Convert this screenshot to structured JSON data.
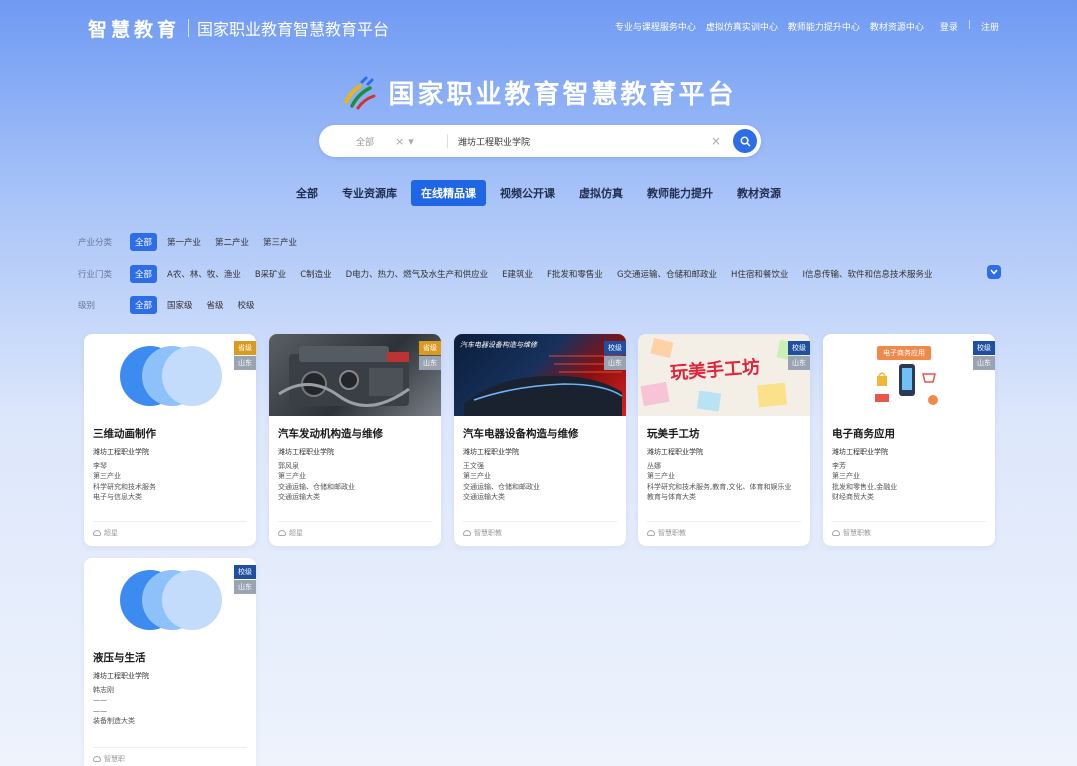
{
  "header": {
    "brand_mark": "智慧教育",
    "brand_name": "国家职业教育智慧教育平台",
    "nav": [
      "专业与课程服务中心",
      "虚拟仿真实训中心",
      "教师能力提升中心",
      "教材资源中心"
    ],
    "login": "登录",
    "sep": "|",
    "register": "注册"
  },
  "hero": {
    "title": "国家职业教育智慧教育平台"
  },
  "search": {
    "scope": "全部",
    "scope_clear": "×",
    "scope_arrow": "▾",
    "value": "潍坊工程职业学院",
    "clear": "×",
    "button_icon": "search-icon"
  },
  "tabs": [
    {
      "label": "全部",
      "active": false
    },
    {
      "label": "专业资源库",
      "active": false
    },
    {
      "label": "在线精品课",
      "active": true
    },
    {
      "label": "视频公开课",
      "active": false
    },
    {
      "label": "虚拟仿真",
      "active": false
    },
    {
      "label": "教师能力提升",
      "active": false
    },
    {
      "label": "教材资源",
      "active": false
    }
  ],
  "filters": {
    "industry": {
      "label": "产业分类",
      "options": [
        "全部",
        "第一产业",
        "第二产业",
        "第三产业"
      ]
    },
    "sector": {
      "label": "行业门类",
      "options": [
        "全部",
        "A农、林、牧、渔业",
        "B采矿业",
        "C制造业",
        "D电力、热力、燃气及水生产和供应业",
        "E建筑业",
        "F批发和零售业",
        "G交通运输、仓储和邮政业",
        "H住宿和餐饮业",
        "I信息传输、软件和信息技术服务业"
      ]
    },
    "level": {
      "label": "级别",
      "options": [
        "全部",
        "国家级",
        "省级",
        "校级"
      ]
    }
  },
  "cards": [
    {
      "title": "三维动画制作",
      "school": "潍坊工程职业学院",
      "lines": [
        "李琴",
        "第三产业",
        "科学研究和技术服务",
        "电子与信息大类"
      ],
      "level": "省级",
      "region": "山东",
      "footer": "超星"
    },
    {
      "title": "汽车发动机构造与维修",
      "school": "潍坊工程职业学院",
      "lines": [
        "郭风泉",
        "第三产业",
        "交通运输、仓储和邮政业",
        "交通运输大类"
      ],
      "level": "省级",
      "region": "山东",
      "footer": "超星"
    },
    {
      "title": "汽车电器设备构造与维修",
      "school": "潍坊工程职业学院",
      "lines": [
        "王文强",
        "第三产业",
        "交通运输、仓储和邮政业",
        "交通运输大类"
      ],
      "level": "校级",
      "region": "山东",
      "footer": "智慧职教",
      "cover_text": "汽车电器设备构造与维修"
    },
    {
      "title": "玩美手工坊",
      "school": "潍坊工程职业学院",
      "lines": [
        "丛娜",
        "第三产业",
        "科学研究和技术服务,教育,文化、体育和娱乐业",
        "教育与体育大类"
      ],
      "level": "校级",
      "region": "山东",
      "footer": "智慧职教",
      "cover_text": "玩美手工坊"
    },
    {
      "title": "电子商务应用",
      "school": "潍坊工程职业学院",
      "lines": [
        "李芳",
        "第三产业",
        "批发和零售业,金融业",
        "财经商贸大类"
      ],
      "level": "校级",
      "region": "山东",
      "footer": "智慧职教",
      "cover_text": "电子商务应用"
    },
    {
      "title": "液压与生活",
      "school": "潍坊工程职业学院",
      "lines": [
        "韩志刚",
        "——",
        "——",
        "装备制造大类"
      ],
      "level": "校级",
      "region": "山东",
      "footer": "智慧职"
    }
  ],
  "colors": {
    "primary": "#2d6ee8",
    "badge_province": "#d99a1e",
    "badge_school": "#1f4f9e",
    "badge_region": "#9aa3b2"
  }
}
